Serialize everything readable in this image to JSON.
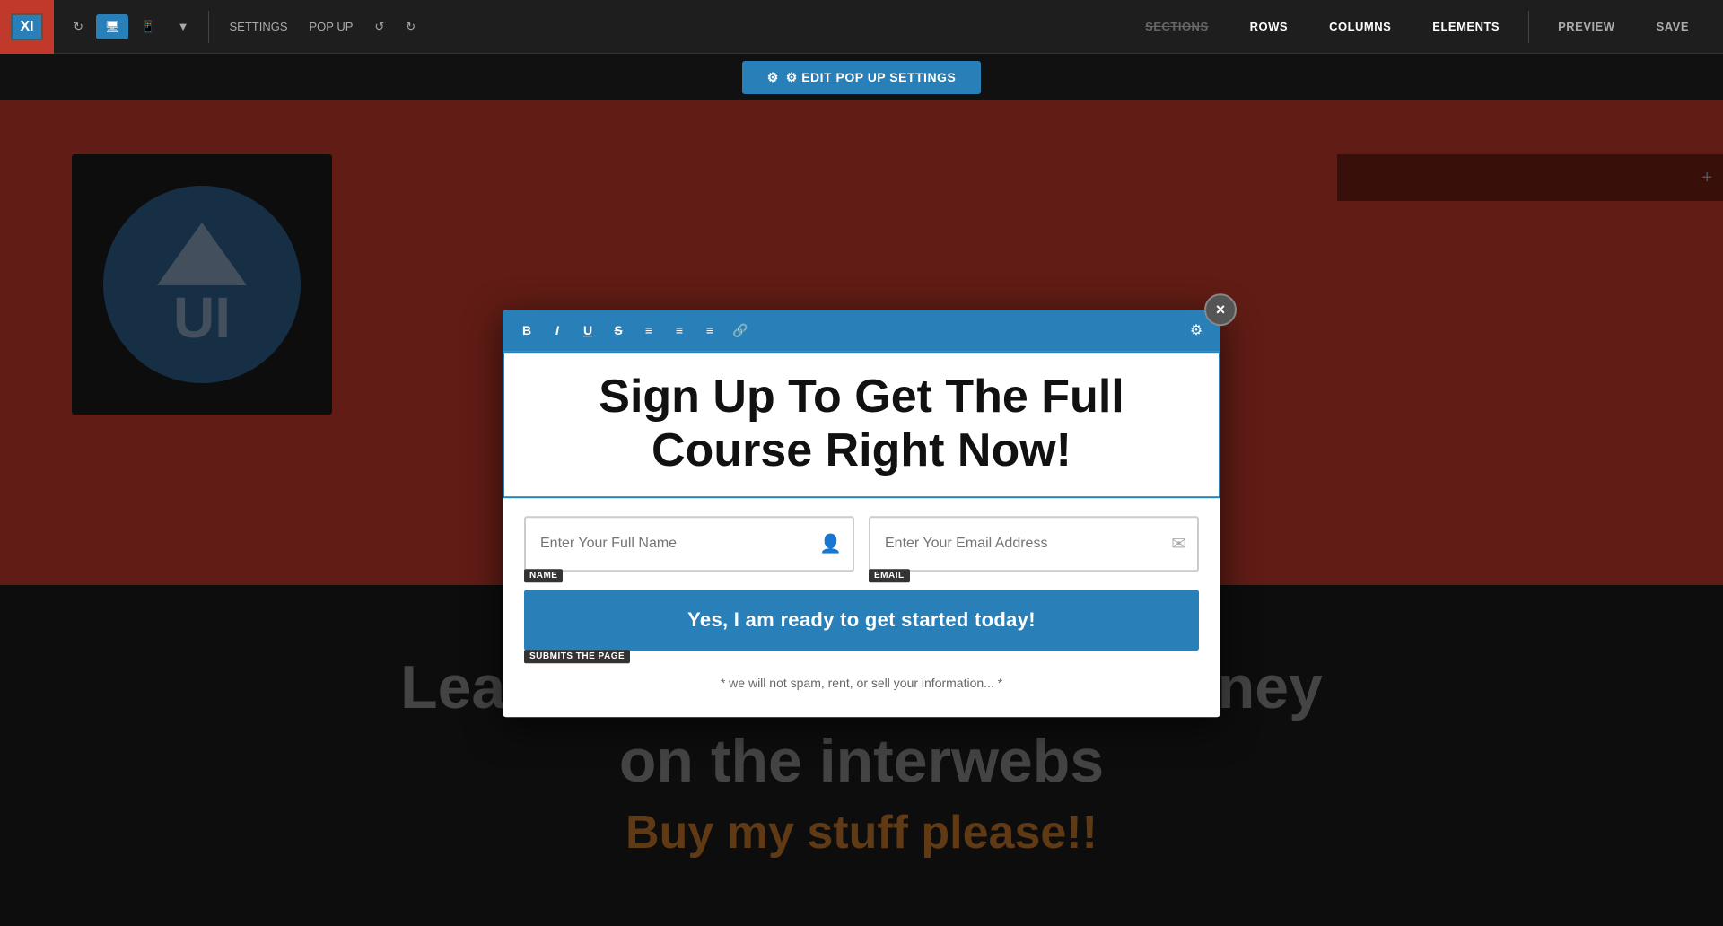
{
  "toolbar": {
    "logo_text": "XI",
    "undo_label": "↺",
    "redo_label": "↻",
    "settings_label": "SETTINGS",
    "popup_label": "POP UP",
    "desktop_icon": "🖥",
    "mobile_icon": "📱",
    "sections_label": "SECTIONS",
    "rows_label": "ROWS",
    "columns_label": "COLUMNS",
    "elements_label": "ELEMENTS",
    "preview_label": "PREVIEW",
    "save_label": "SAVE"
  },
  "edit_popup": {
    "button_label": "⚙ EDIT POP UP SETTINGS"
  },
  "modal": {
    "editor_tools": [
      "B",
      "I",
      "U",
      "S",
      "≡",
      "≡",
      "≡",
      "🔗"
    ],
    "heading": "Sign Up To Get The Full Course Right Now!",
    "name_field_placeholder": "Enter Your Full Name",
    "name_field_label": "NAME",
    "email_field_placeholder": "Enter Your Email Address",
    "email_field_label": "EMAIL",
    "submit_button_label": "Yes, I am ready to get started today!",
    "submits_badge": "SUBMITS THE PAGE",
    "disclaimer": "* we will not spam, rent, or sell your information... *"
  },
  "page": {
    "lower_text_line1": "Learn how to make cash money",
    "lower_text_line2": "on the interwebs",
    "lower_highlight": "Buy my stuff please!!"
  }
}
